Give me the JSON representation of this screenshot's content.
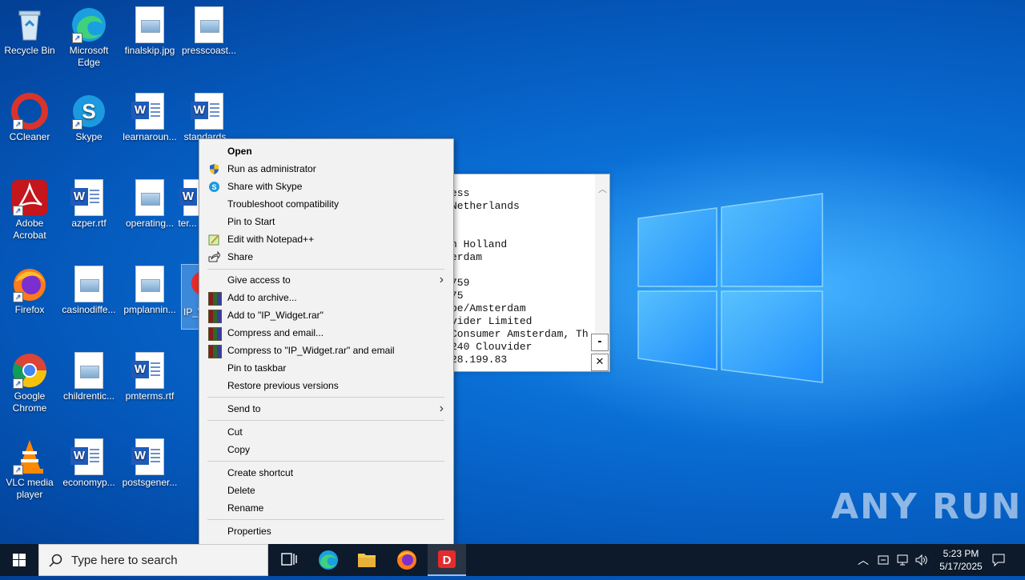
{
  "desktop": {
    "icons": [
      {
        "label": "Recycle Bin"
      },
      {
        "label": "Microsoft Edge"
      },
      {
        "label": "finalskip.jpg"
      },
      {
        "label": "presscoast..."
      },
      {
        "label": "CCleaner"
      },
      {
        "label": "Skype"
      },
      {
        "label": "learnaroun..."
      },
      {
        "label": "standards..."
      },
      {
        "label": "Adobe Acrobat"
      },
      {
        "label": "azper.rtf"
      },
      {
        "label": "operating..."
      },
      {
        "label": "ter..."
      },
      {
        "label": "Firefox"
      },
      {
        "label": "casinodiffe..."
      },
      {
        "label": "pmplannin..."
      },
      {
        "label": "IP_W..."
      },
      {
        "label": "Google Chrome"
      },
      {
        "label": "childrentic..."
      },
      {
        "label": "pmterms.rtf"
      },
      {
        "label": "VLC media player"
      },
      {
        "label": "economyp..."
      },
      {
        "label": "postsgener..."
      }
    ]
  },
  "background_window": {
    "text": "ess\nNetherlands\n\n\nn Holland\nerdam\n\n759\n75\npe/Amsterdam\nvider Limited\nConsumer Amsterdam, Th\n240 Clouvider\n28.199.83",
    "minimize_glyph": "-",
    "close_glyph": "✕"
  },
  "context_menu": {
    "items": [
      {
        "label": "Open",
        "icon": "none"
      },
      {
        "label": "Run as administrator",
        "icon": "shield-icon"
      },
      {
        "label": "Share with Skype",
        "icon": "skype-icon"
      },
      {
        "label": "Troubleshoot compatibility",
        "icon": "none"
      },
      {
        "label": "Pin to Start",
        "icon": "none"
      },
      {
        "label": "Edit with Notepad++",
        "icon": "notepadpp-icon"
      },
      {
        "label": "Share",
        "icon": "share-icon"
      },
      {
        "label": "Give access to",
        "icon": "none",
        "submenu": true
      },
      {
        "label": "Add to archive...",
        "icon": "winrar-icon"
      },
      {
        "label": "Add to \"IP_Widget.rar\"",
        "icon": "winrar-icon"
      },
      {
        "label": "Compress and email...",
        "icon": "winrar-icon"
      },
      {
        "label": "Compress to \"IP_Widget.rar\" and email",
        "icon": "winrar-icon"
      },
      {
        "label": "Pin to taskbar",
        "icon": "none"
      },
      {
        "label": "Restore previous versions",
        "icon": "none"
      },
      {
        "label": "Send to",
        "icon": "none",
        "submenu": true
      },
      {
        "label": "Cut",
        "icon": "none"
      },
      {
        "label": "Copy",
        "icon": "none"
      },
      {
        "label": "Create shortcut",
        "icon": "none"
      },
      {
        "label": "Delete",
        "icon": "none"
      },
      {
        "label": "Rename",
        "icon": "none"
      },
      {
        "label": "Properties",
        "icon": "none"
      }
    ],
    "submenu_glyph": "›"
  },
  "taskbar": {
    "search_placeholder": "Type here to search",
    "time": "5:23 PM",
    "date": "5/17/2025"
  },
  "watermark": "ANY RUN",
  "colors": {
    "desktop_blue": "#0a6fd6",
    "taskbar": "#0c1a2b",
    "menu_bg": "#f2f2f2"
  }
}
